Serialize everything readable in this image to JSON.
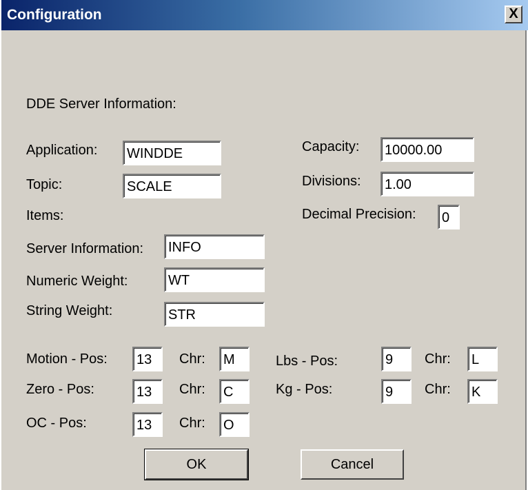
{
  "window": {
    "title": "Configuration",
    "close_glyph": "X"
  },
  "section": {
    "heading": "DDE Server Information:",
    "items_label": "Items:"
  },
  "fields": {
    "application": {
      "label": "Application:",
      "value": "WINDDE"
    },
    "topic": {
      "label": "Topic:",
      "value": "SCALE"
    },
    "capacity": {
      "label": "Capacity:",
      "value": "10000.00"
    },
    "divisions": {
      "label": "Divisions:",
      "value": "1.00"
    },
    "decimal_precision": {
      "label": "Decimal Precision:",
      "value": "0"
    },
    "server_information": {
      "label": "Server Information:",
      "value": "INFO"
    },
    "numeric_weight": {
      "label": "Numeric Weight:",
      "value": "WT"
    },
    "string_weight": {
      "label": "String Weight:",
      "value": "STR"
    }
  },
  "positions": {
    "chr_label": "Chr:",
    "motion": {
      "label": "Motion - Pos:",
      "pos": "13",
      "chr": "M"
    },
    "zero": {
      "label": "Zero - Pos:",
      "pos": "13",
      "chr": "C"
    },
    "oc": {
      "label": "OC - Pos:",
      "pos": "13",
      "chr": "O"
    },
    "lbs": {
      "label": "Lbs - Pos:",
      "pos": "9",
      "chr": "L"
    },
    "kg": {
      "label": "Kg - Pos:",
      "pos": "9",
      "chr": "K"
    }
  },
  "buttons": {
    "ok": "OK",
    "cancel": "Cancel"
  }
}
